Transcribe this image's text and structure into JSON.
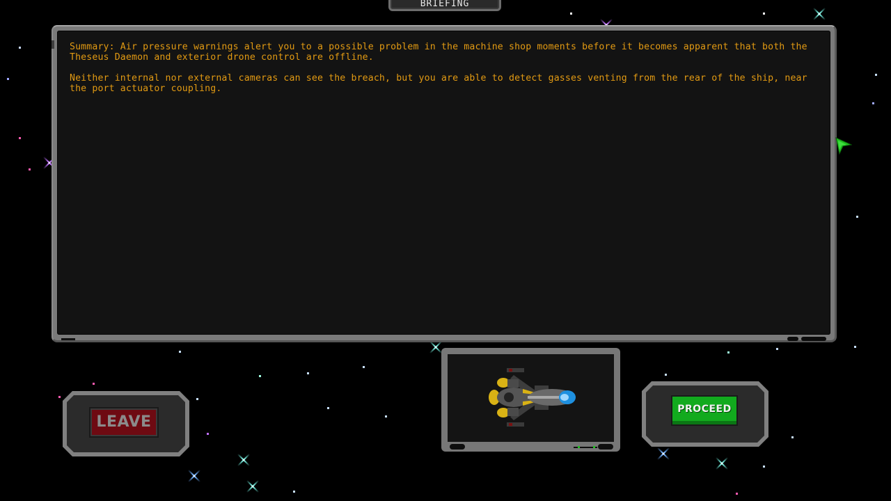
{
  "header": {
    "tab_title": "BRIEFING"
  },
  "briefing": {
    "paragraphs": [
      "Summary: Air pressure warnings alert you to a possible problem in the machine shop moments before it becomes apparent that both the Theseus Daemon and exterior drone control are offline.",
      "Neither internal nor external cameras can see the breach, but you are able to detect gasses venting from the rear of the ship, near the port actuator coupling."
    ]
  },
  "actions": {
    "leave_label": "LEAVE",
    "proceed_label": "PROCEED"
  },
  "ship_preview": {
    "icon": "player-ship-icon"
  },
  "colors": {
    "text_accent": "#e29a13",
    "leave_button": "#6e0a12",
    "proceed_button": "#12aa1e",
    "cursor": "#1fbf1f"
  }
}
